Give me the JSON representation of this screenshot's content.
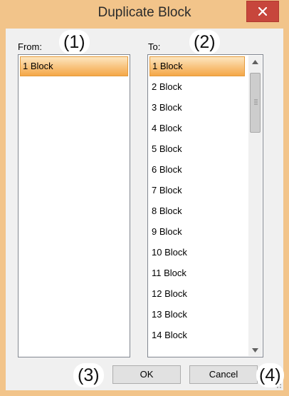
{
  "dialog": {
    "title": "Duplicate Block",
    "close_icon": "close-icon",
    "colors": {
      "frame": "#f2c48a",
      "close_button": "#c7463c",
      "selection": "#f8c27c"
    }
  },
  "from": {
    "label": "From:",
    "marker": "(1)",
    "items": [
      "1 Block"
    ],
    "selected_index": 0
  },
  "to": {
    "label": "To:",
    "marker": "(2)",
    "items": [
      "1 Block",
      "2 Block",
      "3 Block",
      "4 Block",
      "5 Block",
      "6 Block",
      "7 Block",
      "8 Block",
      "9 Block",
      "10 Block",
      "11 Block",
      "12 Block",
      "13 Block",
      "14 Block"
    ],
    "selected_index": 0,
    "scroll_up_icon": "triangle-up-icon",
    "scroll_down_icon": "triangle-down-icon"
  },
  "buttons": {
    "ok_marker": "(3)",
    "ok_label": "OK",
    "cancel_label": "Cancel",
    "cancel_marker": "(4)"
  }
}
